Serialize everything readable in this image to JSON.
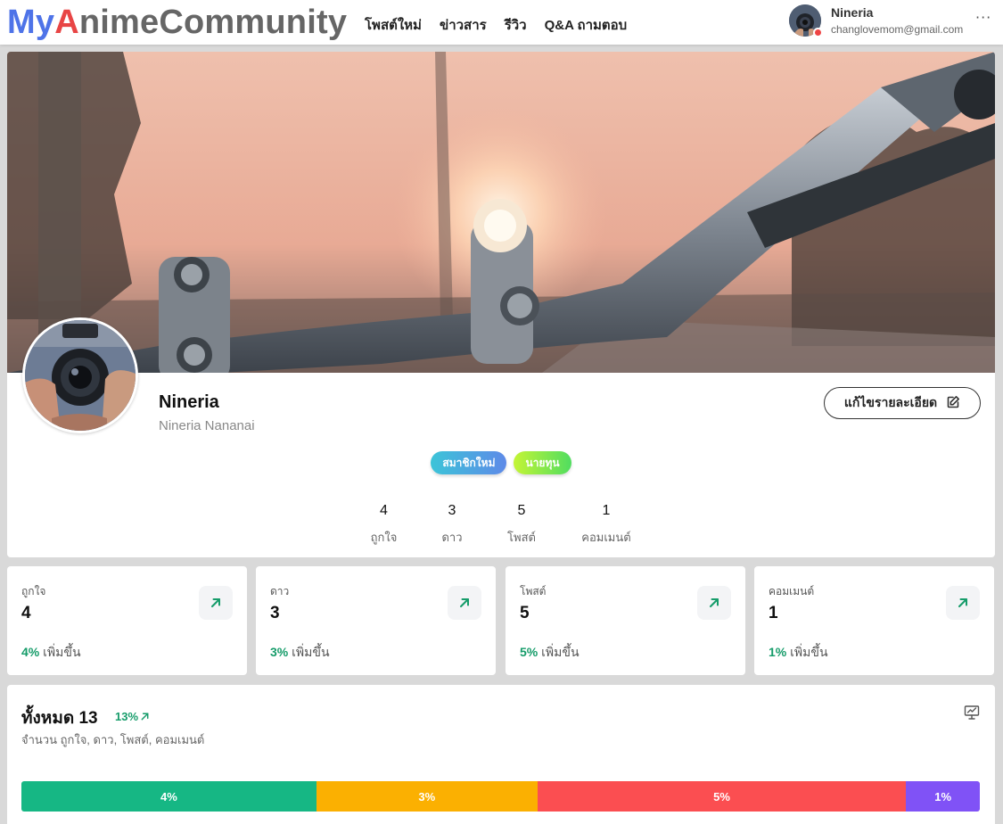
{
  "nav": {
    "logo_part1": "My",
    "logo_part2": "A",
    "logo_part3": "nimeCommunity",
    "menu": [
      "โพสต์ใหม่",
      "ข่าวสาร",
      "รีวิว",
      "Q&A ถามตอบ"
    ],
    "user_name": "Nineria",
    "user_email": "changlovemom@gmail.com",
    "more": "···"
  },
  "profile": {
    "name": "Nineria",
    "handle": "Nineria Nananai",
    "edit_label": "แก้ไขรายละเอียด",
    "badges": [
      "สมาชิกใหม่",
      "นายทุน"
    ],
    "counts": [
      {
        "value": "4",
        "label": "ถูกใจ"
      },
      {
        "value": "3",
        "label": "ดาว"
      },
      {
        "value": "5",
        "label": "โพสต์"
      },
      {
        "value": "1",
        "label": "คอมเมนต์"
      }
    ]
  },
  "stats": [
    {
      "label": "ถูกใจ",
      "value": "4",
      "pct": "4%",
      "trend": "เพิ่มขึ้น"
    },
    {
      "label": "ดาว",
      "value": "3",
      "pct": "3%",
      "trend": "เพิ่มขึ้น"
    },
    {
      "label": "โพสต์",
      "value": "5",
      "pct": "5%",
      "trend": "เพิ่มขึ้น"
    },
    {
      "label": "คอมเมนต์",
      "value": "1",
      "pct": "1%",
      "trend": "เพิ่มขึ้น"
    }
  ],
  "total": {
    "title": "ทั้งหมด 13",
    "pct": "13%",
    "subtitle": "จำนวน ถูกใจ, ดาว, โพสต์, คอมเมนต์",
    "segments": [
      {
        "label": "4%",
        "value": 4,
        "color": "#16b784"
      },
      {
        "label": "3%",
        "value": 3,
        "color": "#fbb001"
      },
      {
        "label": "5%",
        "value": 5,
        "color": "#fb4e51"
      },
      {
        "label": "1%",
        "value": 1,
        "color": "#8052f6"
      }
    ]
  },
  "colors": {
    "logo_blue": "#4e73e8",
    "logo_red": "#e84545",
    "positive_green": "#169c6a",
    "status_red": "#ef4444"
  }
}
